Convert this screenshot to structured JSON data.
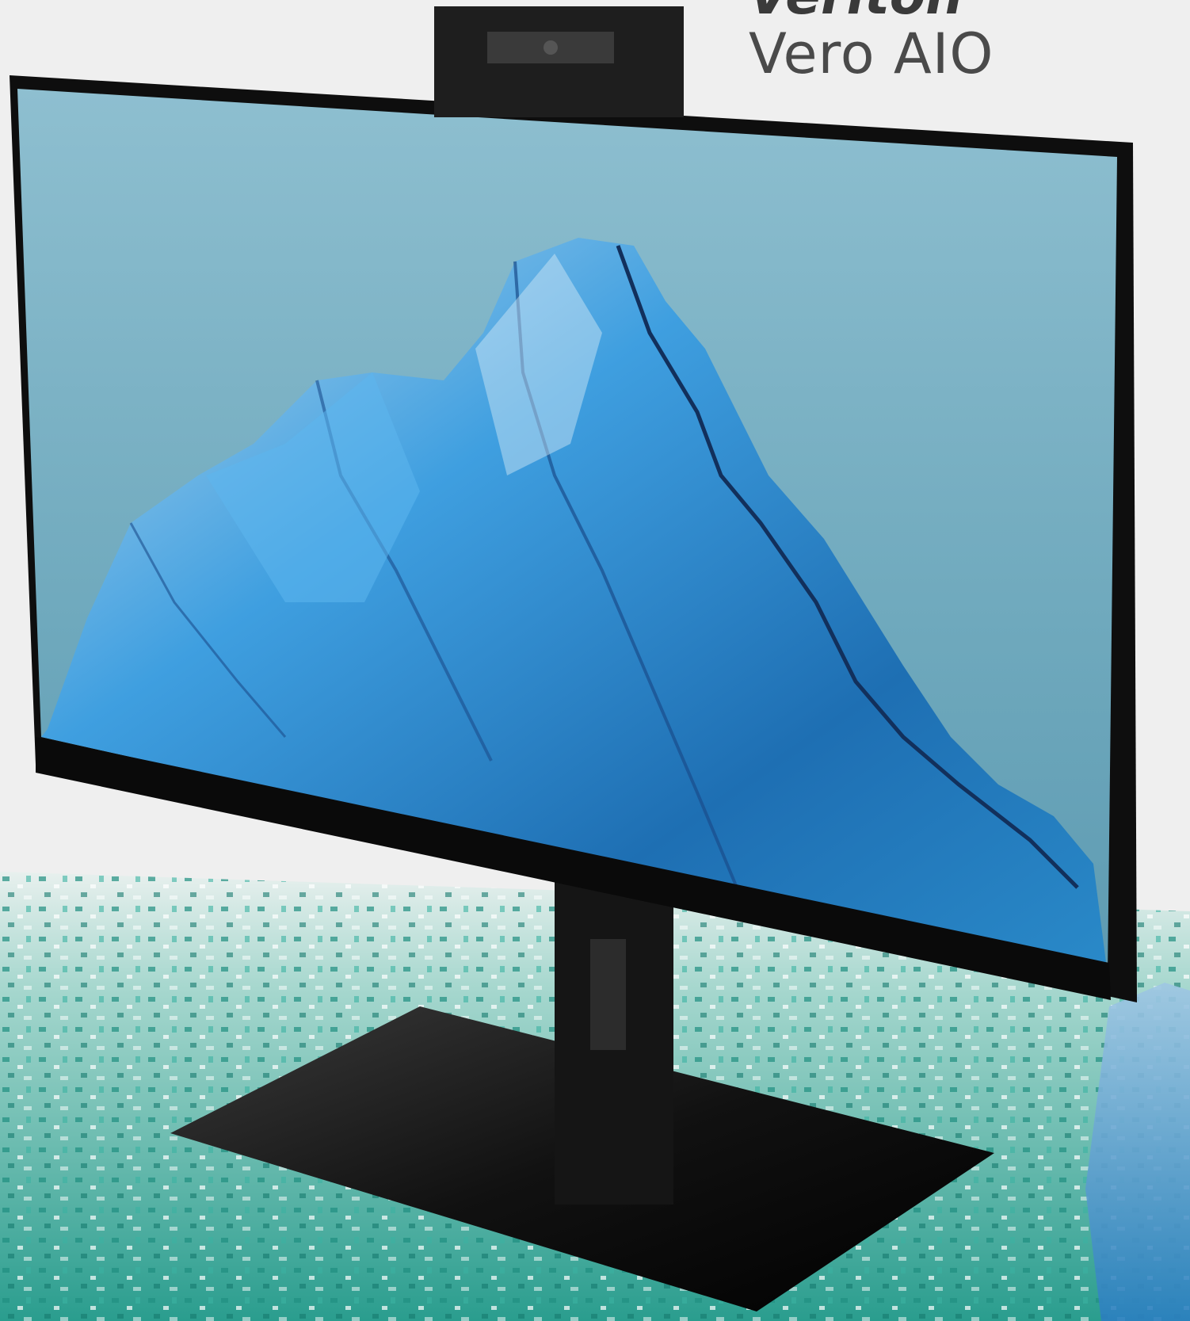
{
  "brand": {
    "series": "Veriton",
    "model": "Vero AIO"
  },
  "colors": {
    "background": "#efefef",
    "screen_sky": "#7fb3c6",
    "ice_blue": "#2f8fd0",
    "bezel": "#111111",
    "floor_teal": "#2aa89a"
  },
  "icons": [
    "webcam-icon"
  ]
}
